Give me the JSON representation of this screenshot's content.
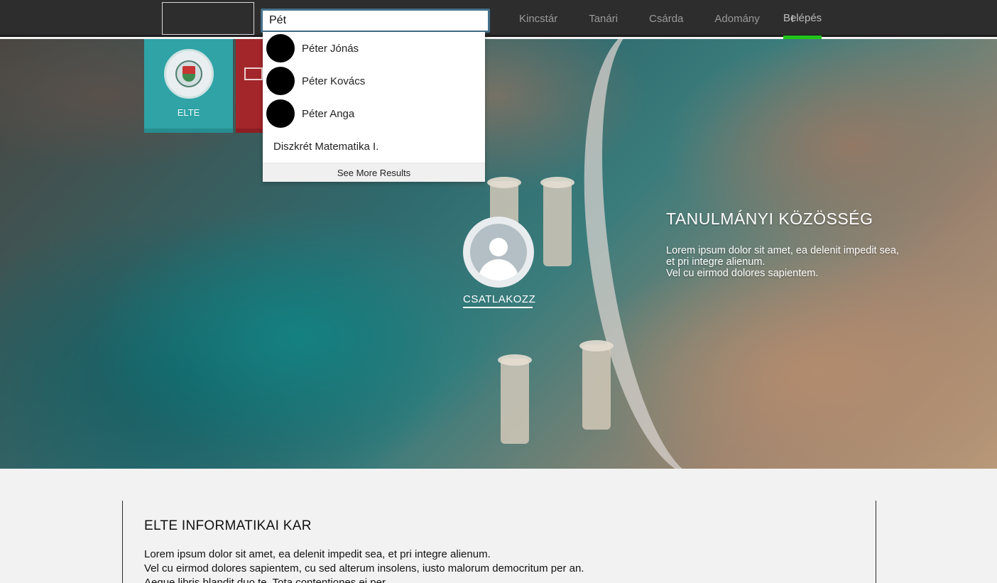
{
  "header": {
    "search_value": "Pét",
    "nav": [
      {
        "label": "Kincstár"
      },
      {
        "label": "Tanári"
      },
      {
        "label": "Csárda"
      },
      {
        "label": "Adomány"
      }
    ],
    "separator": "I",
    "login_label": "Belépés",
    "login_underline_color": "#22c41c"
  },
  "search_results": {
    "people": [
      {
        "name": "Péter Jónás"
      },
      {
        "name": "Péter Kovács"
      },
      {
        "name": "Péter Anga"
      }
    ],
    "courses": [
      {
        "name": "Diszkrét Matematika I."
      }
    ],
    "more_label": "See More Results"
  },
  "tiles": [
    {
      "label": "ELTE",
      "color": "#2fa3a6"
    },
    {
      "label": "",
      "color": "#a3262b"
    }
  ],
  "hero": {
    "join_label": "CSATLAKOZZ",
    "title": "TANULMÁNYI KÖZÖSSÉG",
    "text_lines": [
      "Lorem ipsum dolor sit amet, ea delenit impedit sea,",
      "et pri integre alienum.",
      "Vel cu eirmod dolores sapientem."
    ]
  },
  "content": {
    "title": "ELTE INFORMATIKAI KAR",
    "lines": [
      "Lorem ipsum dolor sit amet, ea delenit impedit sea, et pri integre alienum.",
      "Vel cu eirmod dolores sapientem, cu sed alterum insolens, iusto malorum democritum per an.",
      "Aeque libris blandit duo te. Tota contentiones ei per."
    ]
  }
}
